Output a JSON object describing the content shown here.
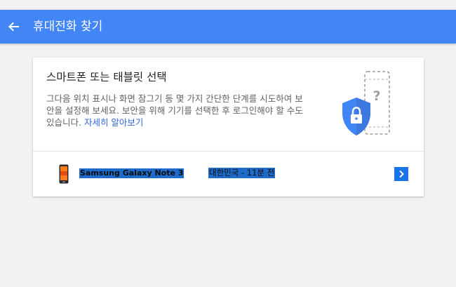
{
  "appbar": {
    "title": "휴대전화 찾기",
    "back_icon": "arrow-back-icon",
    "color": "#4285f4"
  },
  "card": {
    "title": "스마트폰 또는 태블릿 선택",
    "description": "그다음 위치 표시나 화면 잠그기 등 몇 가지 간단한 단계를 시도하여 보안을 설정해 보세요. 보안을 위해 기기를 선택한 후 로그인해야 할 수도 있습니다. ",
    "learn_more": "자세히 알아보기",
    "illustration_icon": "phone-shield-lock-icon"
  },
  "device": {
    "name": "Samsung Galaxy Note 3",
    "status": "대한민국 - 11분 전",
    "phone_icon": "smartphone-icon",
    "chevron_icon": "chevron-right-icon"
  },
  "colors": {
    "accent": "#4285f4",
    "link": "#3367d6",
    "selection": "#1f6bc9"
  }
}
